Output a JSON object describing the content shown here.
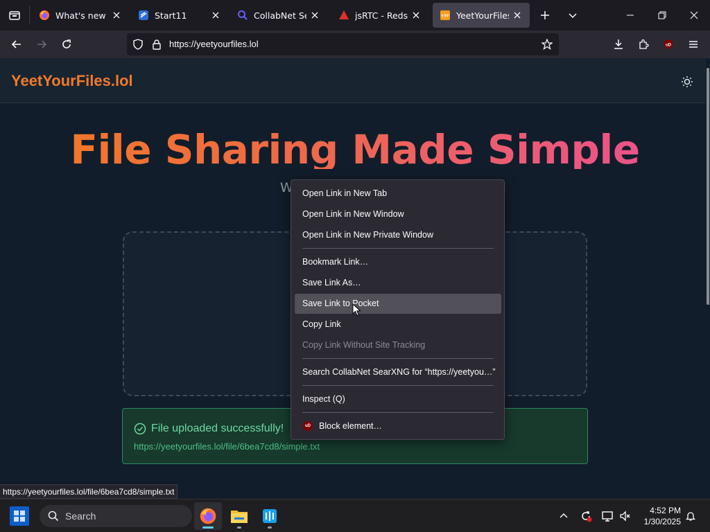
{
  "browser": {
    "tabs": [
      {
        "title": "What's new with",
        "active": false,
        "favicon": "firefox-icon"
      },
      {
        "title": "Start11",
        "active": false,
        "favicon": "start11-icon"
      },
      {
        "title": "CollabNet SearXN",
        "active": false,
        "favicon": "search-icon"
      },
      {
        "title": "jsRTC - Redscien",
        "active": false,
        "favicon": "warning-triangle-icon"
      },
      {
        "title": "YeetYourFiles.lol",
        "active": true,
        "favicon": "yyf-icon"
      }
    ],
    "url": "https://yeetyourfiles.lol",
    "status_link": "https://yeetyourfiles.lol/file/6bea7cd8/simple.txt"
  },
  "page": {
    "logo": "YeetYourFiles.lol",
    "hero_title": "File Sharing Made Simple",
    "subtitle_fragment": "W",
    "success_title": "File uploaded successfully!",
    "success_link": "https://yeetyourfiles.lol/file/6bea7cd8/simple.txt"
  },
  "context_menu": {
    "items": [
      {
        "label": "Open Link in New Tab",
        "state": "normal"
      },
      {
        "label": "Open Link in New Window",
        "state": "normal"
      },
      {
        "label": "Open Link in New Private Window",
        "state": "normal"
      },
      {
        "label": "Bookmark Link…",
        "state": "normal"
      },
      {
        "label": "Save Link As…",
        "state": "normal"
      },
      {
        "label": "Save Link to Pocket",
        "state": "hover"
      },
      {
        "label": "Copy Link",
        "state": "normal"
      },
      {
        "label": "Copy Link Without Site Tracking",
        "state": "disabled"
      },
      {
        "label": "Search CollabNet SearXNG for “https://yeetyou…”",
        "state": "normal"
      },
      {
        "label": "Inspect (Q)",
        "state": "normal"
      },
      {
        "label": "Block element…",
        "state": "normal"
      }
    ],
    "ublock_badge": "uD"
  },
  "taskbar": {
    "search_label": "Search",
    "time": "4:52 PM",
    "date": "1/30/2025"
  },
  "colors": {
    "accent_orange": "#f07a2c",
    "hero_gradient_end": "#e94f93",
    "success_green": "#6fd9a0",
    "menu_bg": "#2b2a33"
  }
}
